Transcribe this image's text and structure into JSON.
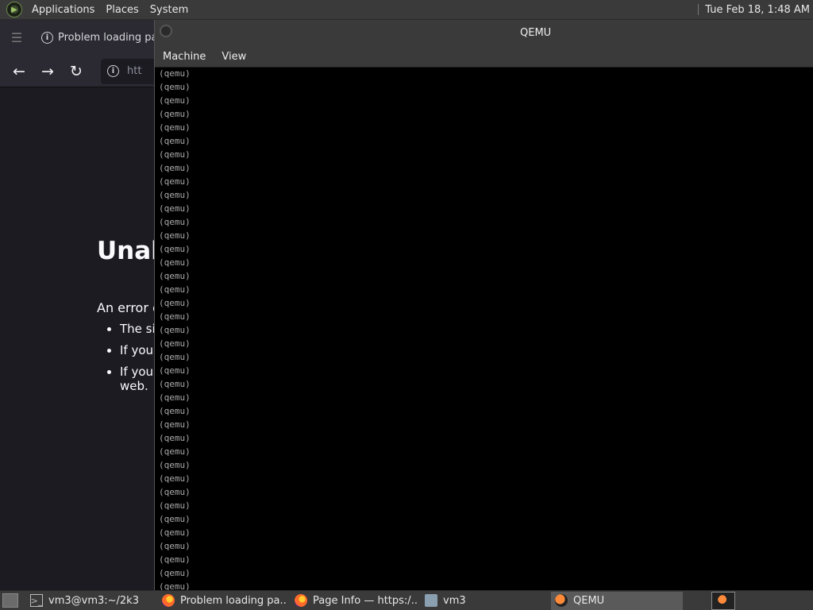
{
  "top_panel": {
    "menus": [
      "Applications",
      "Places",
      "System"
    ],
    "clock": "Tue Feb 18,  1:48 AM"
  },
  "browser": {
    "tab_title": "Problem loading pa",
    "url_partial": "htt",
    "error_title": "Unab",
    "error_desc": "An error c",
    "error_items": [
      "The sit",
      "If you a",
      "If your\nweb."
    ]
  },
  "qemu": {
    "title": "QEMU",
    "menus": [
      "Machine",
      "View"
    ],
    "prompt": "(qemu)",
    "line_count": 39
  },
  "taskbar": {
    "tasks": [
      {
        "label": "vm3@vm3:~/2k3",
        "icon": "terminal-icon",
        "active": false
      },
      {
        "label": "Problem loading pa...",
        "icon": "firefox-icon",
        "active": false
      },
      {
        "label": "Page Info — https:/...",
        "icon": "firefox-icon",
        "active": false
      },
      {
        "label": "vm3",
        "icon": "folder-icon",
        "active": false
      },
      {
        "label": "QEMU",
        "icon": "qemu-icon",
        "active": true
      }
    ]
  },
  "colors": {
    "panel_bg": "#3a3a3a",
    "browser_bg": "#1c1b22",
    "console_fg": "#aaaaaa"
  }
}
